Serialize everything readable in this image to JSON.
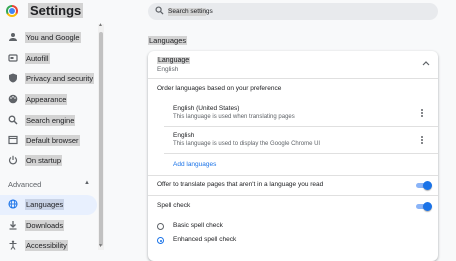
{
  "app": {
    "title": "Settings"
  },
  "search": {
    "placeholder": "Search settings",
    "value": ""
  },
  "sidebar": {
    "items": [
      {
        "label": "You and Google",
        "icon": "person-icon"
      },
      {
        "label": "Autofill",
        "icon": "autofill-icon"
      },
      {
        "label": "Privacy and security",
        "icon": "shield-icon"
      },
      {
        "label": "Appearance",
        "icon": "palette-icon"
      },
      {
        "label": "Search engine",
        "icon": "search-icon"
      },
      {
        "label": "Default browser",
        "icon": "browser-icon"
      },
      {
        "label": "On startup",
        "icon": "power-icon"
      }
    ],
    "advanced_label": "Advanced",
    "advanced_items": [
      {
        "label": "Languages",
        "icon": "globe-icon",
        "active": true
      },
      {
        "label": "Downloads",
        "icon": "download-icon"
      },
      {
        "label": "Accessibility",
        "icon": "accessibility-icon"
      }
    ]
  },
  "main": {
    "section_title": "Languages",
    "language_row": {
      "title": "Language",
      "value": "English"
    },
    "order_label": "Order languages based on your preference",
    "languages": [
      {
        "name": "English (United States)",
        "description": "This language is used when translating pages"
      },
      {
        "name": "English",
        "description": "This language is used to display the Google Chrome UI"
      }
    ],
    "add_languages_label": "Add languages",
    "translate_offer": {
      "label": "Offer to translate pages that aren't in a language you read",
      "enabled": true
    },
    "spell_check": {
      "label": "Spell check",
      "enabled": true
    },
    "spell_options": [
      {
        "label": "Basic spell check",
        "checked": false
      },
      {
        "label": "Enhanced spell check",
        "checked": true
      }
    ]
  },
  "colors": {
    "accent": "#1a73e8",
    "active_nav_bg": "#e8f0fe",
    "page_bg": "#f8f9fa"
  }
}
